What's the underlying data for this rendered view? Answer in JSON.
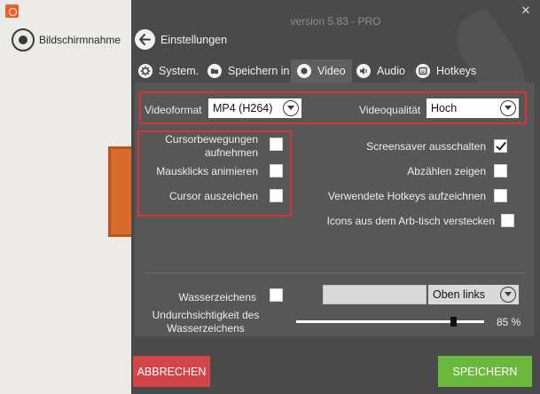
{
  "background_app": {
    "title": "Bildschirmnahme"
  },
  "window": {
    "version": "version 5.83 - PRO",
    "close_glyph": "✕"
  },
  "nav": {
    "back_label": "Einstellungen"
  },
  "tabs": [
    {
      "label": "System.",
      "icon": "gear-icon"
    },
    {
      "label": "Speichern in",
      "icon": "folder-icon"
    },
    {
      "label": "Video",
      "icon": "record-icon",
      "active": true
    },
    {
      "label": "Audio",
      "icon": "speaker-icon"
    },
    {
      "label": "Hotkeys",
      "icon": "keyboard-icon"
    }
  ],
  "video": {
    "format_label": "Videoformat",
    "format_value": "MP4 (H264)",
    "quality_label": "Videoqualität",
    "quality_value": "Hoch",
    "left_options": [
      {
        "label": "Cursorbewegungen aufnehmen",
        "checked": false
      },
      {
        "label": "Mausklicks animieren",
        "checked": false
      },
      {
        "label": "Cursor auszeichen",
        "checked": false
      }
    ],
    "right_options": [
      {
        "label": "Screensaver ausschalten",
        "checked": true
      },
      {
        "label": "Abzählen zeigen",
        "checked": false
      },
      {
        "label": "Verwendete Hotkeys aufzeichnen",
        "checked": false
      },
      {
        "label": "Icons aus dem Arb-tisch verstecken",
        "checked": false
      }
    ],
    "watermark_label": "Wasserzeichens",
    "watermark_checked": false,
    "watermark_text": "",
    "watermark_position": "Oben links",
    "opacity_label": "Undurchsichtigkeit des Wasserzeichens",
    "opacity_value": 85,
    "opacity_display": "85 %"
  },
  "buttons": {
    "cancel": "ABBRECHEN",
    "save": "SPEICHERN"
  },
  "colors": {
    "panel_bg": "#4a4a4a",
    "content_bg": "#575757",
    "highlight": "#d6333a",
    "cancel": "#d4454a",
    "save": "#6bb83e"
  }
}
